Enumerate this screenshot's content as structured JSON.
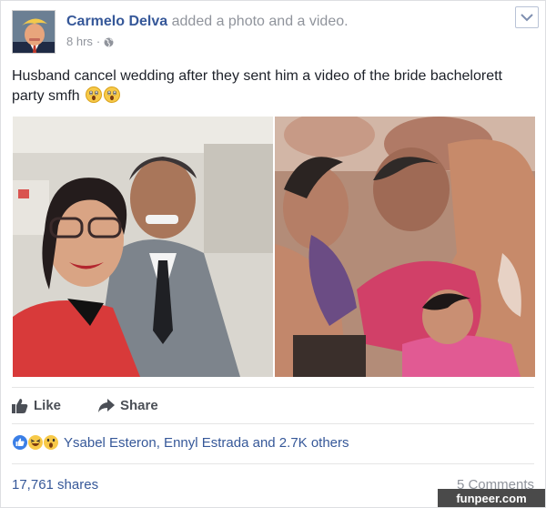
{
  "post": {
    "author": "Carmelo Delva",
    "action": "added a photo and a video.",
    "time": "8 hrs",
    "text": "Husband cancel wedding after they sent him a video of the bride bachelorett party smfh"
  },
  "actions": {
    "like_label": "Like",
    "share_label": "Share"
  },
  "reactions": {
    "names": "Ysabel Esteron, Ennyl Estrada and 2.7K others"
  },
  "stats": {
    "shares": "17,761 shares",
    "comments": "5 Comments"
  },
  "watermark": {
    "text": "funpeer.com"
  },
  "icons": {
    "avatar": "avatar",
    "globe": "globe-icon",
    "menu": "chevron-down-icon",
    "like": "thumbs-up-icon",
    "share": "share-arrow-icon",
    "emoji": "surprised-emoji-icon",
    "react_like": "like-reaction-icon",
    "react_haha": "haha-reaction-icon",
    "react_wow": "wow-reaction-icon"
  },
  "colors": {
    "link": "#365899",
    "meta": "#90949c",
    "text": "#1d2129"
  }
}
